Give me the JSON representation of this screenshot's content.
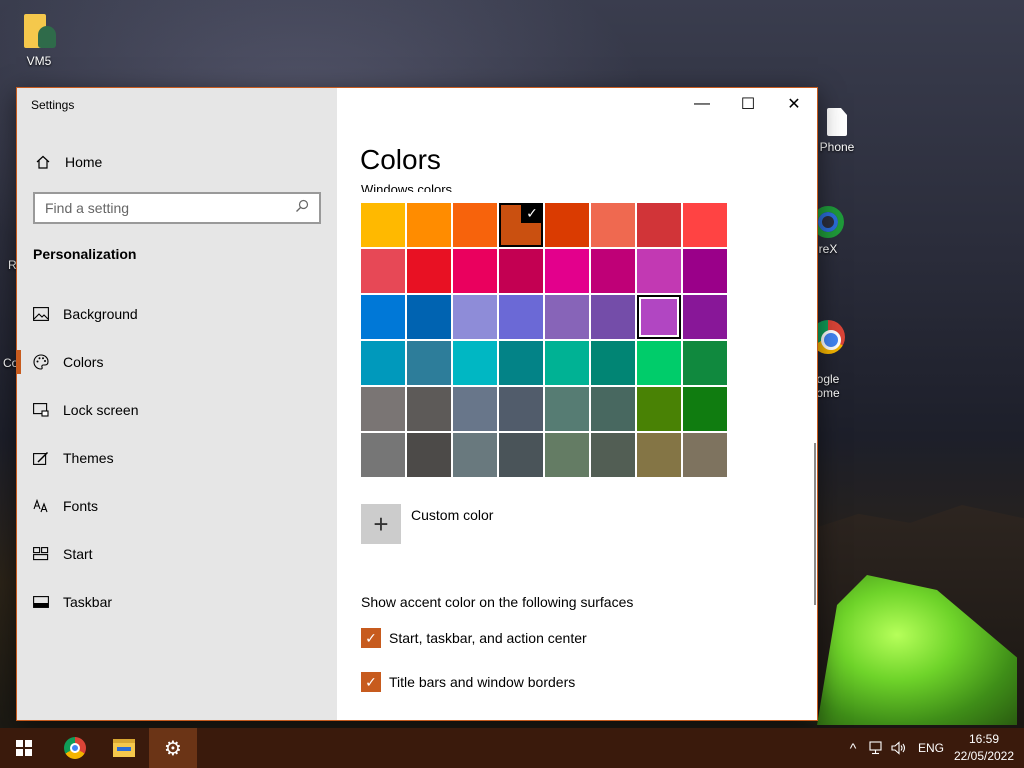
{
  "desktop": {
    "icons": [
      {
        "label": "VM5"
      },
      {
        "label": "Phone"
      },
      {
        "label": "reX"
      },
      {
        "label": "ogle\nome"
      }
    ],
    "edge_labels": [
      "R",
      "Co"
    ]
  },
  "window": {
    "app_title": "Settings",
    "controls": {
      "minimize": "—",
      "maximize": "☐",
      "close": "✕"
    }
  },
  "sidebar": {
    "home_label": "Home",
    "search_placeholder": "Find a setting",
    "section": "Personalization",
    "items": [
      {
        "label": "Background",
        "icon": "image-icon"
      },
      {
        "label": "Colors",
        "icon": "palette-icon",
        "active": true
      },
      {
        "label": "Lock screen",
        "icon": "lock-screen-icon"
      },
      {
        "label": "Themes",
        "icon": "themes-icon"
      },
      {
        "label": "Fonts",
        "icon": "fonts-icon"
      },
      {
        "label": "Start",
        "icon": "start-icon"
      },
      {
        "label": "Taskbar",
        "icon": "taskbar-icon"
      }
    ]
  },
  "content": {
    "title": "Colors",
    "windows_colors_label": "Windows colors",
    "swatches": [
      "#FFB900",
      "#FF8C00",
      "#F7630C",
      "#CA5010",
      "#DA3B01",
      "#EF6950",
      "#D13438",
      "#FF4343",
      "#E74856",
      "#E81123",
      "#EA005E",
      "#C30052",
      "#E3008C",
      "#BF0077",
      "#C239B3",
      "#9A0089",
      "#0078D7",
      "#0063B1",
      "#8E8CD8",
      "#6B69D6",
      "#8764B8",
      "#744DA9",
      "#B146C2",
      "#881798",
      "#0099BC",
      "#2D7D9A",
      "#00B7C3",
      "#038387",
      "#00B294",
      "#018574",
      "#00CC6A",
      "#10893E",
      "#7A7574",
      "#5D5A58",
      "#68768A",
      "#515C6B",
      "#567C73",
      "#486860",
      "#498205",
      "#107C10",
      "#767676",
      "#4C4A48",
      "#69797E",
      "#4A5459",
      "#647C64",
      "#525E54",
      "#847545",
      "#7E735F"
    ],
    "selected_index": 3,
    "hovered_index": 22,
    "custom_color_label": "Custom color",
    "surfaces_label": "Show accent color on the following surfaces",
    "checkboxes": [
      {
        "label": "Start, taskbar, and action center",
        "checked": true
      },
      {
        "label": "Title bars and window borders",
        "checked": true
      }
    ]
  },
  "taskbar": {
    "tray": {
      "language": "ENG"
    },
    "clock": {
      "time": "16:59",
      "date": "22/05/2022"
    }
  },
  "accent_color": "#C75B1E"
}
